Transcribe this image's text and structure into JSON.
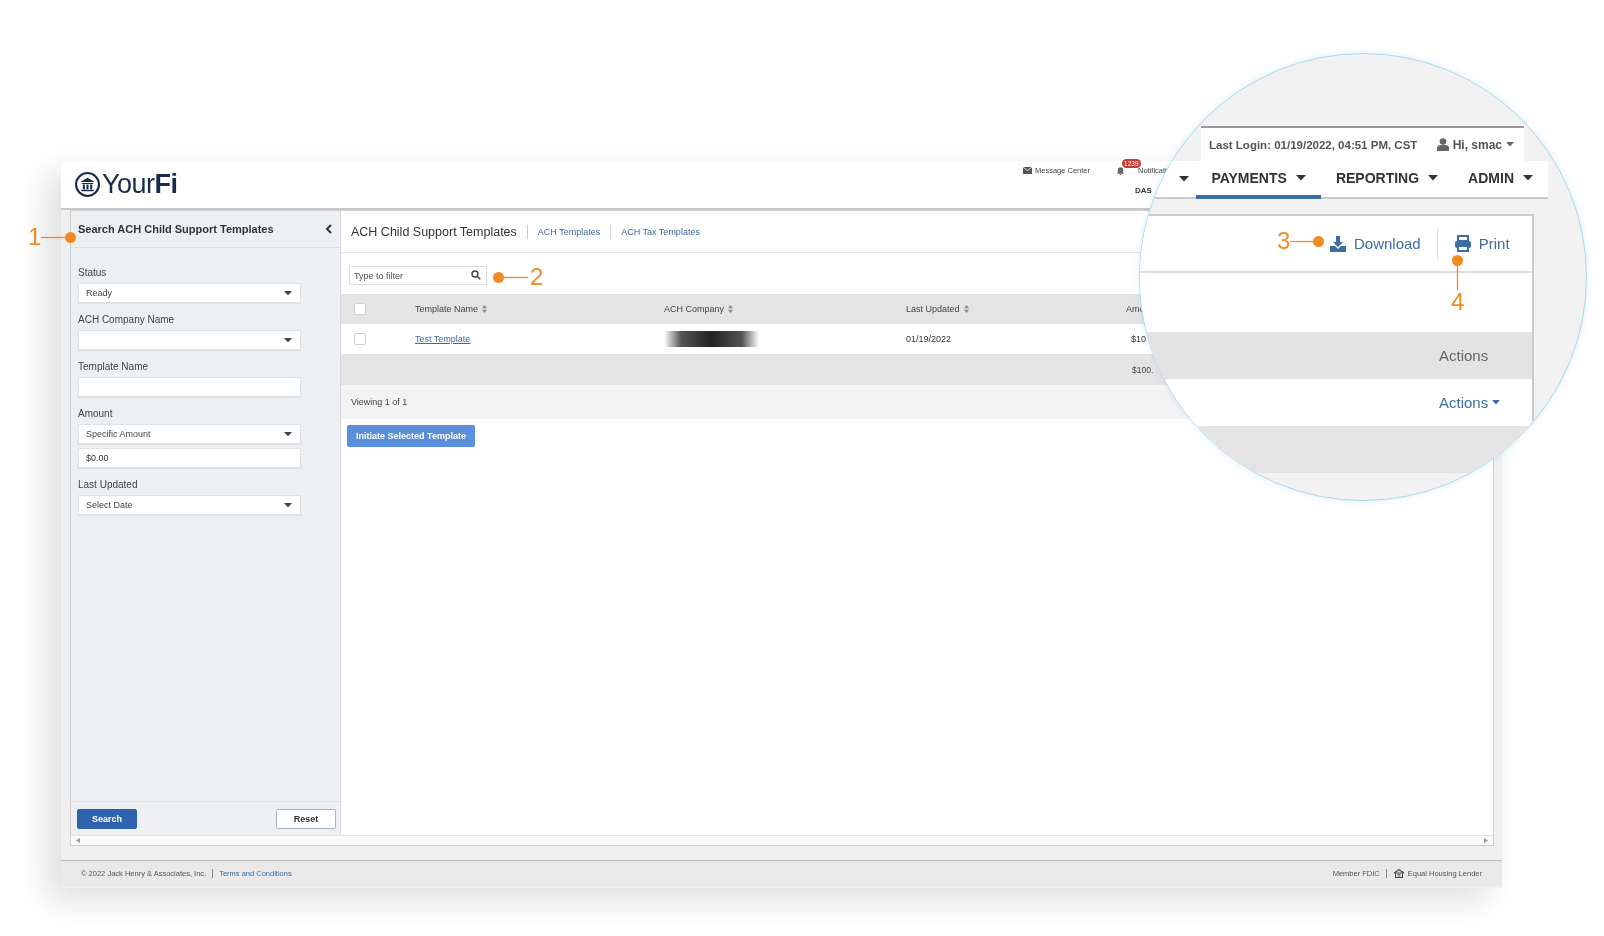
{
  "header": {
    "logo": "Your**Fi**",
    "message_center": "Message Center",
    "notification_count": "1239",
    "notifications": "Notificati",
    "nav_partial": "DAS"
  },
  "sidebar": {
    "title": "Search ACH Child Support Templates",
    "fields": [
      {
        "label": "Status",
        "kind": "select",
        "value": "Ready"
      },
      {
        "label": "ACH Company Name",
        "kind": "select"
      },
      {
        "label": "Template Name",
        "kind": "text"
      },
      {
        "label": "Amount",
        "kind": "select",
        "value": "Specific Amount"
      },
      {
        "kind": "text",
        "value": "$0.00"
      },
      {
        "label": "Last Updated",
        "kind": "select",
        "value": "Select Date"
      }
    ],
    "buttons": [
      {
        "label": "Search",
        "kind": "primary"
      },
      {
        "label": "Reset",
        "kind": "secondary"
      }
    ]
  },
  "main": {
    "title": "ACH Child Support Templates",
    "links": [
      "ACH Templates",
      "ACH Tax Templates"
    ],
    "filter": {
      "placeholder": "Type to filter"
    },
    "table": {
      "header_checked": false,
      "columns": [
        "Template Name",
        "ACH Company",
        "Last Updated",
        "Amo"
      ],
      "rows": [
        {
          "checked": false,
          "cells": [
            {
              "kind": "link",
              "text": "Test Template"
            },
            {
              "kind": "redacted"
            },
            {
              "kind": "text",
              "text": "01/19/2022"
            },
            {
              "kind": "text",
              "text": "$10"
            }
          ]
        }
      ],
      "total": "$100.",
      "viewing": "Viewing 1 of 1"
    },
    "initiate_button": "Initiate Selected Template"
  },
  "footer": {
    "copyright": "© 2022 Jack Henry & Associates, Inc.",
    "terms": "Terms and Conditions",
    "member": "Member FDIC",
    "housing": "Equal Housing Lender"
  },
  "magnifier": {
    "last_login": "Last Login: 01/19/2022, 04:51 PM, CST",
    "user": "Hi, smac",
    "nav": [
      {
        "label": "PAYMENTS",
        "selected": true
      },
      {
        "label": "REPORTING",
        "selected": false
      },
      {
        "label": "ADMIN",
        "selected": false
      }
    ],
    "download": "Download",
    "print": "Print",
    "actions_header": "Actions",
    "actions_menu": "Actions"
  },
  "callouts": [
    {
      "number": "1"
    },
    {
      "number": "2"
    },
    {
      "number": "3"
    },
    {
      "number": "4"
    }
  ]
}
